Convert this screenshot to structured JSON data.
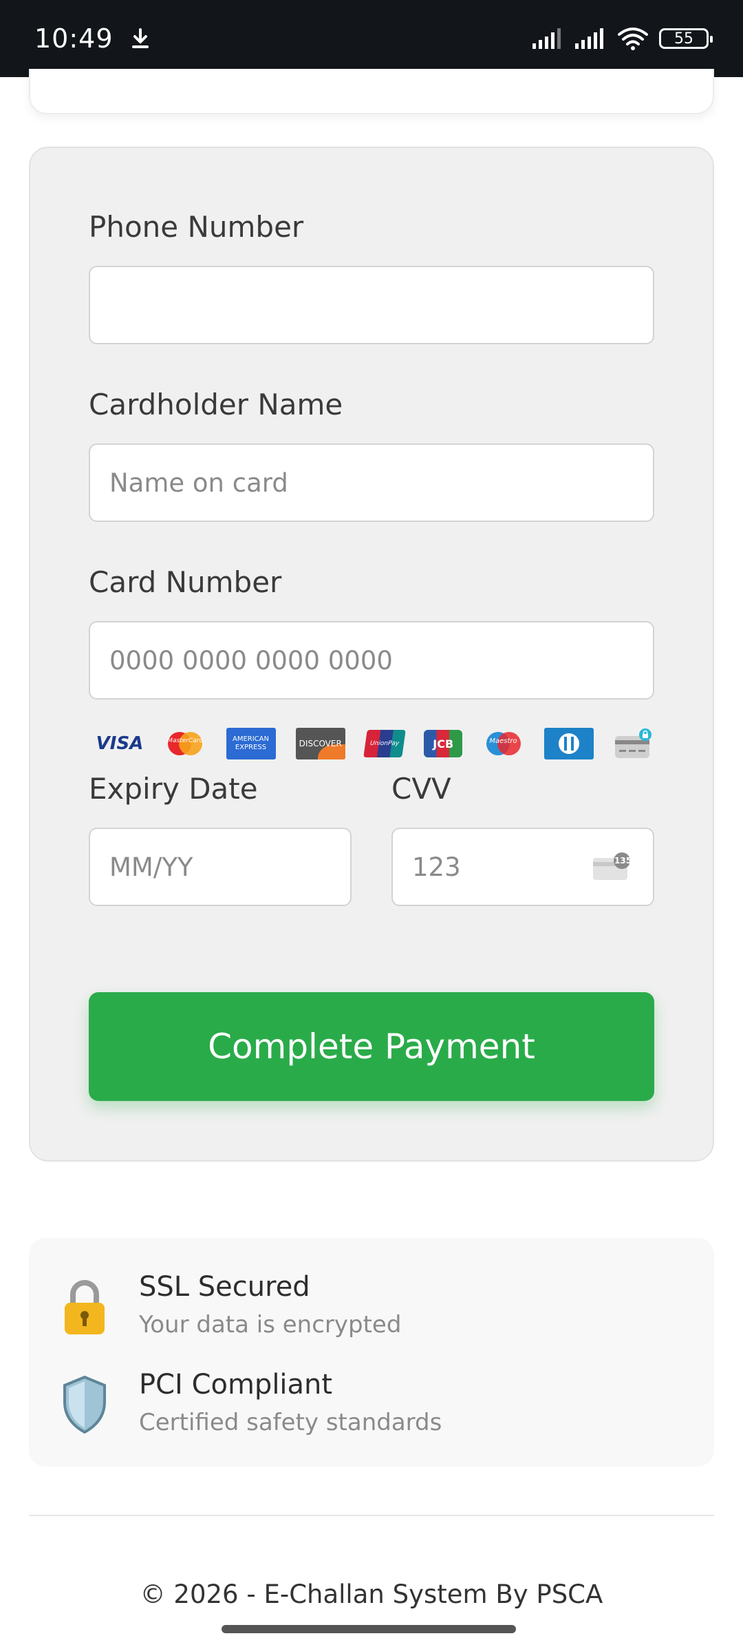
{
  "status_bar": {
    "time": "10:49",
    "battery": "55",
    "icons": [
      "download-icon",
      "signal-icon",
      "signal-icon",
      "wifi-icon",
      "battery-icon"
    ]
  },
  "form": {
    "phone_label": "Phone Number",
    "phone_value": "",
    "name_label": "Cardholder Name",
    "name_placeholder": "Name on card",
    "card_label": "Card Number",
    "card_placeholder": "0000 0000 0000 0000",
    "card_brands": [
      {
        "name": "visa",
        "text": "VISA"
      },
      {
        "name": "mastercard",
        "text": "MasterCard"
      },
      {
        "name": "amex",
        "text": "AMERICAN EXPRESS"
      },
      {
        "name": "discover",
        "text": "DISCOVER"
      },
      {
        "name": "unionpay",
        "text": "UnionPay"
      },
      {
        "name": "jcb",
        "text": "JCB"
      },
      {
        "name": "maestro",
        "text": "Maestro"
      },
      {
        "name": "diners",
        "text": ""
      },
      {
        "name": "generic-card",
        "text": ""
      }
    ],
    "expiry_label": "Expiry Date",
    "expiry_placeholder": "MM/YY",
    "cvv_label": "CVV",
    "cvv_placeholder": "123",
    "cvv_icon_text": "135",
    "submit_label": "Complete Payment"
  },
  "security": {
    "items": [
      {
        "icon": "lock-icon",
        "title": "SSL Secured",
        "subtitle": "Your data is encrypted"
      },
      {
        "icon": "shield-icon",
        "title": "PCI Compliant",
        "subtitle": "Certified safety standards"
      }
    ]
  },
  "footer": {
    "text": "© 2026 - E-Challan System By PSCA"
  },
  "colors": {
    "primary_button": "#2aab4a",
    "status_bar_bg": "#12161a",
    "card_bg": "#f0f0f0"
  }
}
